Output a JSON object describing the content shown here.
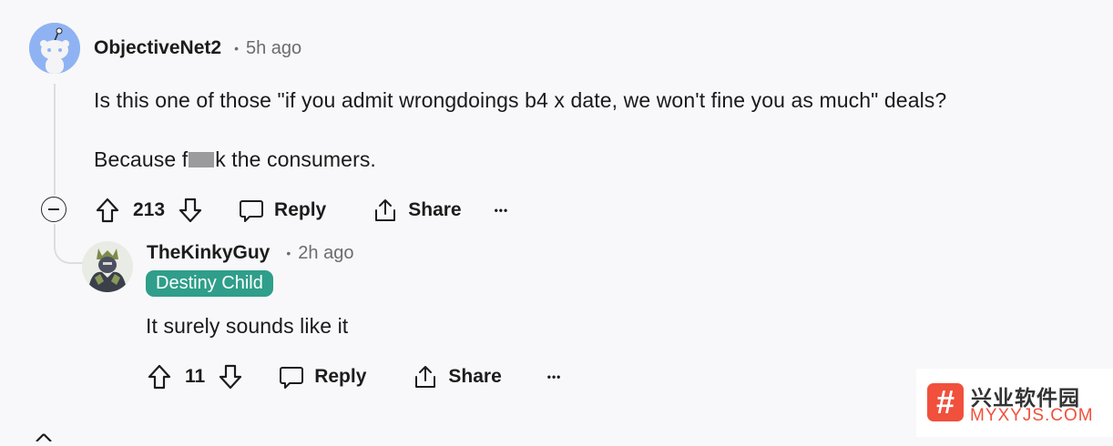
{
  "comment": {
    "username": "ObjectiveNet2",
    "separator": "•",
    "time": "5h ago",
    "line1": "Is this one of those \"if you admit wrongdoings b4 x date, we won't fine you as much\" deals?",
    "line2_before": "Because f",
    "line2_after": "k the consumers.",
    "upvotes": "213",
    "reply_label": "Reply",
    "share_label": "Share",
    "more_label": "•••"
  },
  "reply": {
    "username": "TheKinkyGuy",
    "separator": "•",
    "time": "2h ago",
    "flair": "Destiny Child",
    "text": "It surely sounds like it",
    "upvotes": "11",
    "reply_label": "Reply",
    "share_label": "Share",
    "more_label": "•••"
  },
  "watermark": {
    "symbol": "#",
    "name": "兴业软件园",
    "domain": "MYXYJS.COM"
  },
  "colors": {
    "background": "#f8f8fa",
    "flair_bg": "#2f9e8a",
    "avatar1_bg": "#8fb3f2",
    "watermark_accent": "#f0503c"
  },
  "icons": [
    "upvote-icon",
    "downvote-icon",
    "comment-icon",
    "share-icon",
    "collapse-icon",
    "more-icon"
  ]
}
